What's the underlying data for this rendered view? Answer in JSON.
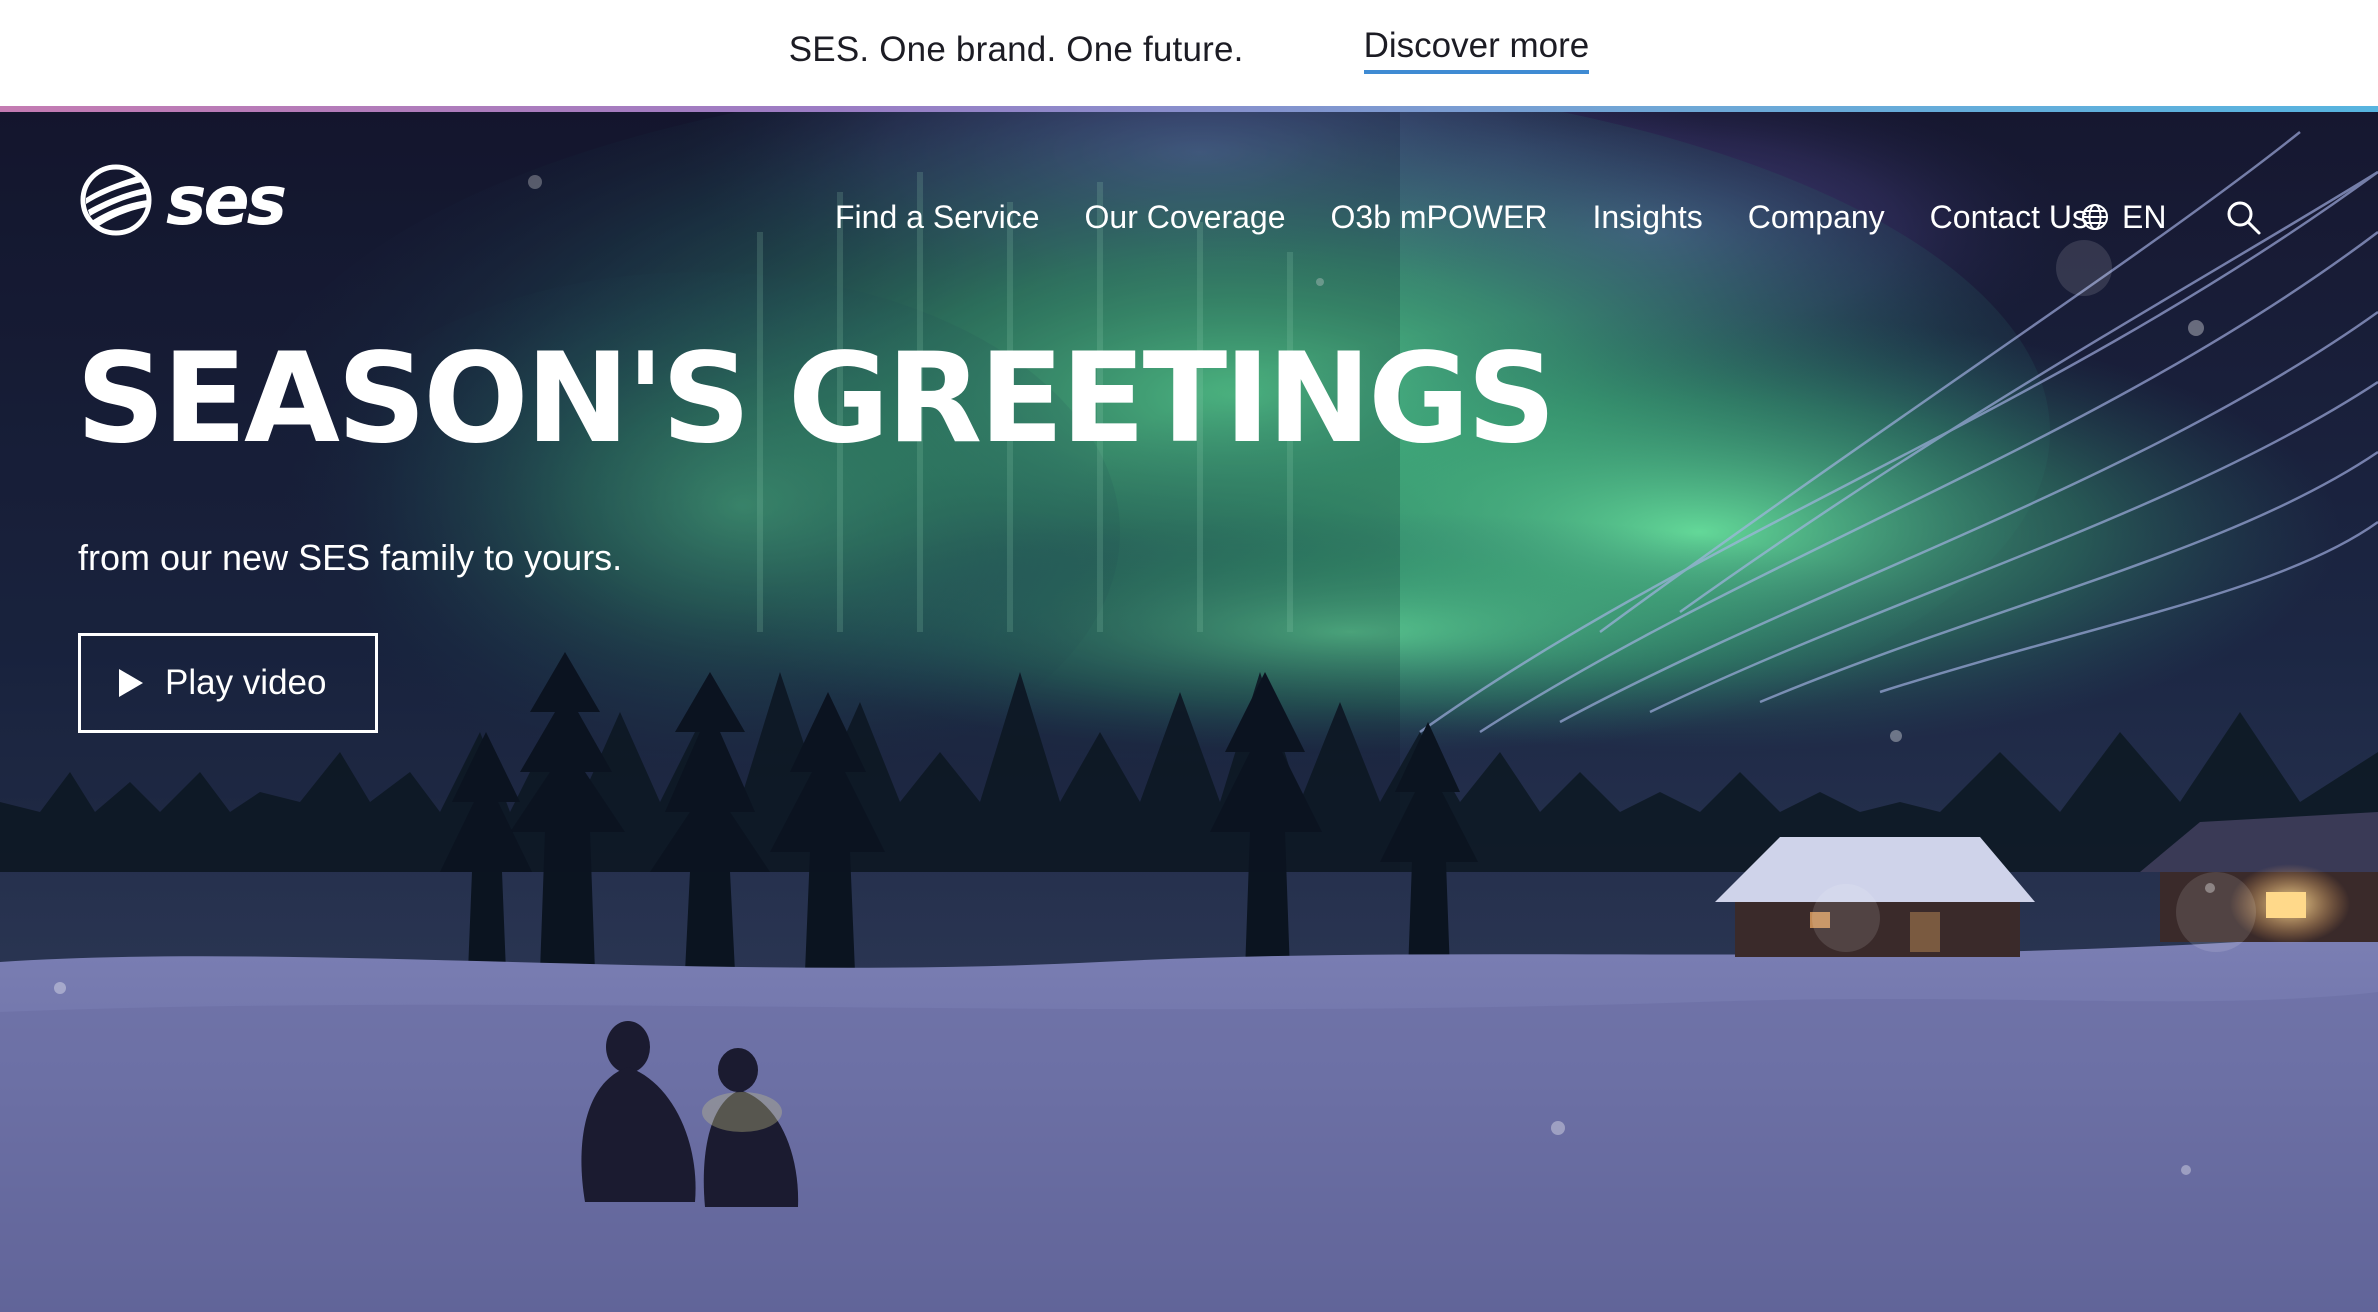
{
  "announcement": {
    "text": "SES. One brand. One future.",
    "link_label": "Discover more",
    "underline_color": "#3f8bd3"
  },
  "brand": {
    "logo_icon": "ses-logo-icon",
    "logo_text": "ses"
  },
  "nav": {
    "items": [
      {
        "label": "Find a Service"
      },
      {
        "label": "Our Coverage"
      },
      {
        "label": "O3b mPOWER"
      },
      {
        "label": "Insights"
      },
      {
        "label": "Company"
      },
      {
        "label": "Contact Us"
      }
    ],
    "language": "EN",
    "language_icon": "globe-icon",
    "search_icon": "search-icon"
  },
  "hero": {
    "headline": "SEASON'S GREETINGS",
    "subline": "from our new SES family to yours.",
    "play_button_label": "Play video",
    "play_icon": "play-icon",
    "background": "aurora-winter-night-scene",
    "colors": {
      "sky_dark": "#12132b",
      "aurora_green": "#4fcf86",
      "aurora_violet": "#6a5fb0",
      "snow": "#8a8dbd"
    }
  },
  "strip": {
    "colors": [
      "#c47bb2",
      "#9b7cc4",
      "#6fa7d6",
      "#57b4df"
    ]
  }
}
